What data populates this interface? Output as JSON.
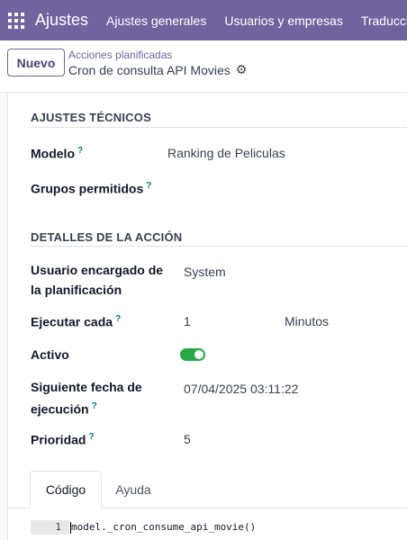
{
  "navbar": {
    "apps_icon": "grid-icon",
    "brand": "Ajustes",
    "menu": [
      "Ajustes generales",
      "Usuarios y empresas",
      "Traduccion"
    ]
  },
  "control": {
    "new_button": "Nuevo",
    "breadcrumb": "Acciones planificadas",
    "record_title": "Cron de consulta API Movies",
    "gear_icon": "gear-icon"
  },
  "technical": {
    "title": "AJUSTES TÉCNICOS",
    "model_label": "Modelo",
    "model_value": "Ranking de Peliculas",
    "groups_label": "Grupos permitidos",
    "help_mark": "?"
  },
  "action": {
    "title": "DETALLES DE LA ACCIÓN",
    "user_label_line1": "Usuario encargado de",
    "user_label_line2": "la planificación",
    "user_value": "System",
    "interval_label": "Ejecutar cada",
    "interval_number": "1",
    "interval_unit": "Minutos",
    "active_label": "Activo",
    "active_value": true,
    "next_label_line1": "Siguiente fecha de",
    "next_label_line2": "ejecución",
    "next_value": "07/04/2025 03:11:22",
    "priority_label": "Prioridad",
    "priority_value": "5"
  },
  "tabs": {
    "code": "Código",
    "help": "Ayuda"
  },
  "code": {
    "line_number": "1",
    "line": "model._cron_consume_api_movie()"
  },
  "colors": {
    "navbar": "#71639e",
    "toggle_on": "#28a745",
    "help_mark": "#017e84"
  }
}
